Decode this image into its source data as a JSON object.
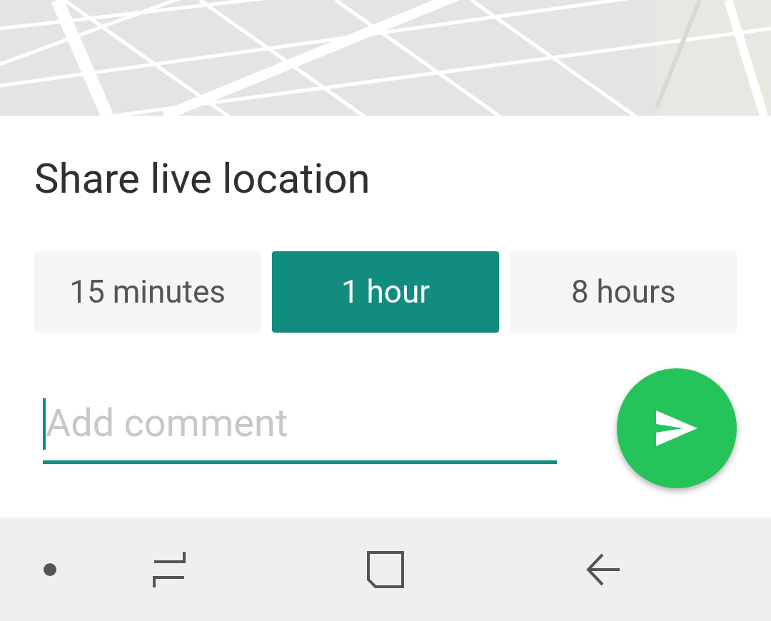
{
  "title": "Share live location",
  "durations": [
    {
      "label": "15 minutes",
      "selected": false
    },
    {
      "label": "1 hour",
      "selected": true
    },
    {
      "label": "8 hours",
      "selected": false
    }
  ],
  "comment": {
    "placeholder": "Add comment"
  }
}
